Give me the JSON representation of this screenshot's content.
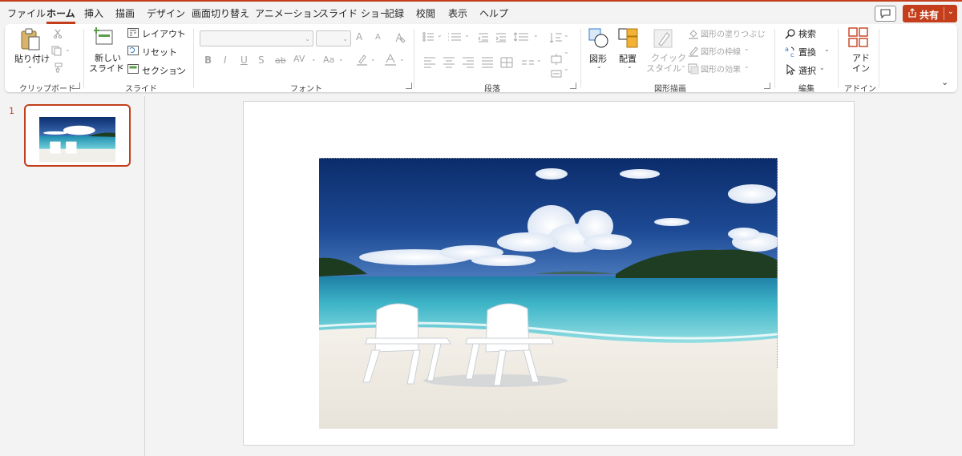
{
  "menu": {
    "tabs": [
      "ファイル",
      "ホーム",
      "挿入",
      "描画",
      "デザイン",
      "画面切り替え",
      "アニメーション",
      "スライド ショー",
      "記録",
      "校閲",
      "表示",
      "ヘルプ"
    ],
    "active_tab": "ホーム"
  },
  "share": {
    "label": "共有"
  },
  "ribbon": {
    "clipboard": {
      "paste_label": "貼り付け",
      "group_label": "クリップボード"
    },
    "slides": {
      "new_slide_line1": "新しい",
      "new_slide_line2": "スライド",
      "layout_label": "レイアウト",
      "reset_label": "リセット",
      "section_label": "セクション",
      "group_label": "スライド"
    },
    "font": {
      "group_label": "フォント",
      "bold": "B",
      "italic": "I",
      "underline": "U",
      "shadow": "S",
      "strike": "ab",
      "spacing": "AV",
      "case": "Aa",
      "grow": "A",
      "shrink": "A"
    },
    "paragraph": {
      "group_label": "段落"
    },
    "drawing": {
      "shape_label": "図形",
      "arrange_label": "配置",
      "quick_style_line1": "クイック",
      "quick_style_line2": "スタイル",
      "fill_label": "図形の塗りつぶし",
      "outline_label": "図形の枠線",
      "effect_label": "図形の効果",
      "group_label": "図形描画"
    },
    "editing": {
      "find_label": "検索",
      "replace_label": "置換",
      "select_label": "選択",
      "group_label": "編集"
    },
    "addin": {
      "label_line1": "アド",
      "label_line2": "イン",
      "group_label": "アドイン"
    }
  },
  "slides_panel": {
    "slide_number": "1"
  },
  "colors": {
    "accent": "#c43e1c",
    "ribbon_bg": "#ffffff",
    "app_bg": "#f3f3f3"
  }
}
